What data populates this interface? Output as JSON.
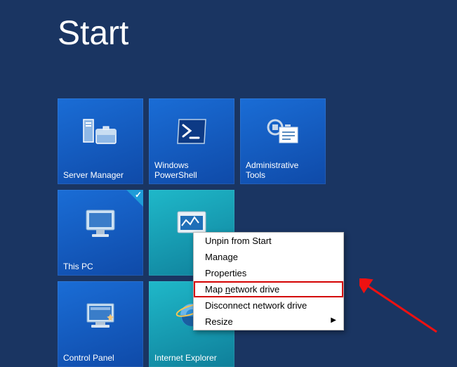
{
  "header": {
    "title": "Start"
  },
  "tiles": [
    {
      "label": "Server Manager"
    },
    {
      "label": "Windows PowerShell"
    },
    {
      "label": "Administrative Tools"
    },
    {
      "label": "This PC"
    },
    {
      "label": "Task Manager"
    },
    {
      "label": "Control Panel"
    },
    {
      "label": "Internet Explorer"
    }
  ],
  "ctx": {
    "items": [
      "Unpin from Start",
      "Manage",
      "Properties",
      "Map network drive",
      "Disconnect network drive",
      "Resize"
    ],
    "highlighted_index": 3
  },
  "colors": {
    "bg": "#1a3562",
    "tile": "#1a6dd6",
    "teal": "#1fb8c9",
    "highlight": "#d40202"
  }
}
